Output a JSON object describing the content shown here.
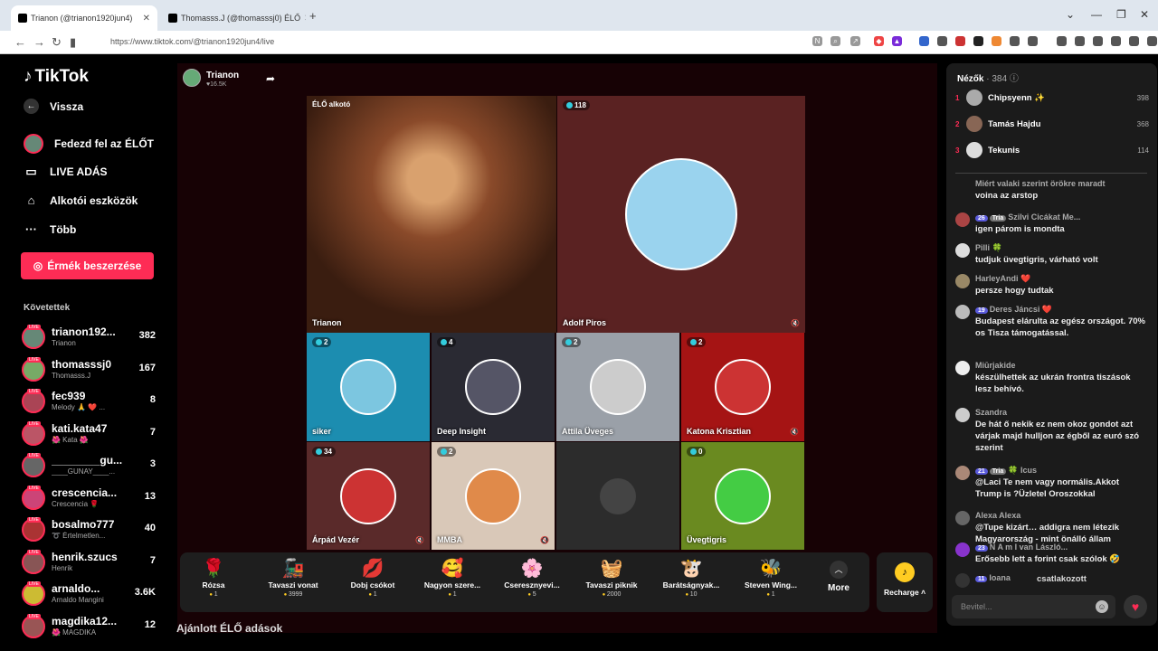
{
  "browser": {
    "tab1_title": "Trianon (@trianon1920jun4)",
    "tab2_title": "Thomasss.J (@thomasssj0) ÉLŐ",
    "url": "https://www.tiktok.com/@trianon1920jun4/live"
  },
  "sidebar": {
    "logo": "TikTok",
    "back": "Vissza",
    "nav": [
      {
        "label": "Fedezd fel az ÉLŐT"
      },
      {
        "label": "LIVE ADÁS"
      },
      {
        "label": "Alkotói eszközök"
      },
      {
        "label": "Több"
      }
    ],
    "coins_button": "Érmék beszerzése",
    "followed_title": "Követettek",
    "followed": [
      {
        "name": "trianon192...",
        "sub": "Trianon",
        "count": "382"
      },
      {
        "name": "thomasssj0",
        "sub": "Thomasss.J",
        "count": "167"
      },
      {
        "name": "fec939",
        "sub": "Melody 🙏 ❤️ ...",
        "count": "8"
      },
      {
        "name": "kati.kata47",
        "sub": "🌺 Kata 🌺",
        "count": "7"
      },
      {
        "name": "________gu...",
        "sub": "____GUNAY____...",
        "count": "3"
      },
      {
        "name": "crescencia...",
        "sub": "Crescencia 🌹",
        "count": "13"
      },
      {
        "name": "bosalmo777",
        "sub": "➰ Értelmetlen...",
        "count": "40"
      },
      {
        "name": "henrik.szucs",
        "sub": "Henrik",
        "count": "7"
      },
      {
        "name": "arnaldo...",
        "sub": "Arnaldo Mangini",
        "count": "3.6K"
      },
      {
        "name": "magdika12...",
        "sub": "🌺 MAGDIKA",
        "count": "12"
      }
    ]
  },
  "stage": {
    "host_name": "Trianon",
    "host_likes": "♥16.5K",
    "main_tile": {
      "tag": "ÉLŐ alkotó",
      "label": "Trianon"
    },
    "tiles": [
      {
        "label": "Adolf Piros",
        "badge": "118"
      },
      {
        "label": "siker",
        "badge": "2"
      },
      {
        "label": "Deep Insight",
        "badge": "4"
      },
      {
        "label": "Attila Üveges",
        "badge": "2"
      },
      {
        "label": "Katona Krisztian",
        "badge": "2"
      },
      {
        "label": "Árpád Vezér",
        "badge": "34"
      },
      {
        "label": "MMBA",
        "badge": "2"
      },
      {
        "label": "",
        "badge": ""
      },
      {
        "label": "Üvegtigris",
        "badge": "0"
      }
    ]
  },
  "gifts": [
    {
      "name": "Rózsa",
      "price": "1",
      "icon": "🌹"
    },
    {
      "name": "Tavaszi vonat",
      "price": "3999",
      "icon": "🚂"
    },
    {
      "name": "Dobj csókot",
      "price": "1",
      "icon": "💋"
    },
    {
      "name": "Nagyon szere...",
      "price": "1",
      "icon": "🥰"
    },
    {
      "name": "Cseresznyevi...",
      "price": "5",
      "icon": "🌸"
    },
    {
      "name": "Tavaszi piknik",
      "price": "2000",
      "icon": "🧺"
    },
    {
      "name": "Barátságnyak...",
      "price": "10",
      "icon": "🐮"
    },
    {
      "name": "Steven Wing...",
      "price": "1",
      "icon": "🐝"
    }
  ],
  "more_label": "More",
  "recharge_label": "Recharge",
  "below_title": "Ajánlott ÉLŐ adások",
  "chat": {
    "viewers_title": "Nézők",
    "viewers_count": "· 384",
    "top": [
      {
        "rank": "1",
        "name": "Chipsyenn ✨",
        "score": "398"
      },
      {
        "rank": "2",
        "name": "Tamás Hajdu",
        "score": "368"
      },
      {
        "rank": "3",
        "name": "Tekunis",
        "score": "114"
      }
    ],
    "messages": [
      {
        "name": "Miért valaki szerint örökre maradt",
        "text": "voina az arstop"
      },
      {
        "name": "Szilvi Cicákat Me...",
        "text": "igen párom is mondta",
        "level": "26",
        "tier": "Tria"
      },
      {
        "name": "Pilli 🍀",
        "text": "tudjuk üvegtigris, várható volt"
      },
      {
        "name": "HarleyAndi ❤️",
        "text": "persze hogy tudtak"
      },
      {
        "name": "Deres Jáncsi ❤️",
        "text": "Budapest elárulta az egész országot. 70% os Tisza támogatással.",
        "level": "19"
      },
      {
        "name": "Miūrjakide",
        "text": "készülhettek az ukrán frontra tiszások lesz behívó."
      },
      {
        "name": "Szandra",
        "text": "De hát ő nekik ez nem okoz gondot azt várjak majd hulljon az égből az euró szó szerint"
      },
      {
        "name": "🍀 Icus",
        "text": "@Laci Te nem vagy normális.Akkot Trump is ?Üzletel Oroszokkal",
        "level": "21",
        "tier": "Tria"
      },
      {
        "name": "Alexa Alexa",
        "text": "@Tupe kizárt… addigra nem létezik Magyarország - mint önálló állam"
      },
      {
        "name": "N A m I van László...",
        "text": "Erősebb lett a forint csak szólok 🤣",
        "level": "23"
      },
      {
        "name": "Ioana",
        "text": "csatlakozott",
        "level": "11"
      }
    ],
    "input_placeholder": "Bevitel..."
  }
}
